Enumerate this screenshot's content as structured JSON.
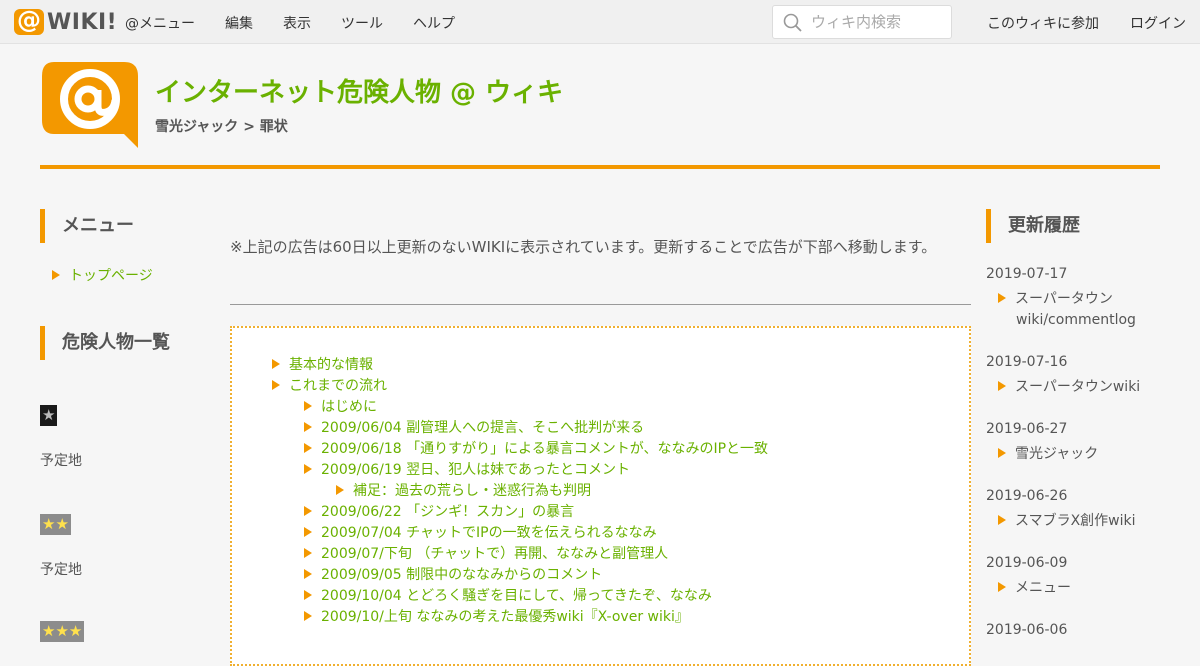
{
  "topbar": {
    "logo_text": "WIKI!",
    "nav": [
      "@メニュー",
      "編集",
      "表示",
      "ツール",
      "ヘルプ"
    ],
    "search_placeholder": "ウィキ内検索",
    "join": "このウィキに参加",
    "login": "ログイン"
  },
  "header": {
    "title": "インターネット危険人物 @ ウィキ",
    "breadcrumb_parent": "雪光ジャック",
    "breadcrumb_sep": ">",
    "breadcrumb_current": "罪状"
  },
  "left_sidebar": {
    "menu_heading": "メニュー",
    "menu_items": [
      "トップページ"
    ],
    "list_heading": "危険人物一覧",
    "ratings": [
      {
        "stars": "★",
        "label": "予定地"
      },
      {
        "stars": "★★",
        "label": "予定地"
      },
      {
        "stars": "★★★",
        "label": ""
      }
    ]
  },
  "main": {
    "notice": "※上記の広告は60日以上更新のないWIKIに表示されています。更新することで広告が下部へ移動します。",
    "toc": [
      {
        "level": 1,
        "text": "基本的な情報"
      },
      {
        "level": 1,
        "text": "これまでの流れ"
      },
      {
        "level": 2,
        "text": "はじめに"
      },
      {
        "level": 2,
        "text": "2009/06/04 副管理人への提言、そこへ批判が来る"
      },
      {
        "level": 2,
        "text": "2009/06/18 「通りすがり」による暴言コメントが、ななみのIPと一致"
      },
      {
        "level": 2,
        "text": "2009/06/19 翌日、犯人は妹であったとコメント"
      },
      {
        "level": 3,
        "text": "補足：過去の荒らし・迷惑行為も判明"
      },
      {
        "level": 2,
        "text": "2009/06/22 「ジンギ！スカン」の暴言"
      },
      {
        "level": 2,
        "text": "2009/07/04 チャットでIPの一致を伝えられるななみ"
      },
      {
        "level": 2,
        "text": "2009/07/下旬 （チャットで）再開、ななみと副管理人"
      },
      {
        "level": 2,
        "text": "2009/09/05 制限中のななみからのコメント"
      },
      {
        "level": 2,
        "text": "2009/10/04 とどろく騒ぎを目にして、帰ってきたぞ、ななみ"
      },
      {
        "level": 2,
        "text": "2009/10/上旬 ななみの考えた最優秀wiki『X-over wiki』"
      }
    ]
  },
  "right_sidebar": {
    "heading": "更新履歴",
    "entries": [
      {
        "date": "2019-07-17",
        "item": "スーパータウンwiki/commentlog"
      },
      {
        "date": "2019-07-16",
        "item": "スーパータウンwiki"
      },
      {
        "date": "2019-06-27",
        "item": "雪光ジャック"
      },
      {
        "date": "2019-06-26",
        "item": "スマブラX創作wiki"
      },
      {
        "date": "2019-06-09",
        "item": "メニュー"
      },
      {
        "date": "2019-06-06",
        "item": ""
      }
    ]
  },
  "colors": {
    "accent": "#f39800",
    "link": "#6ab100"
  }
}
